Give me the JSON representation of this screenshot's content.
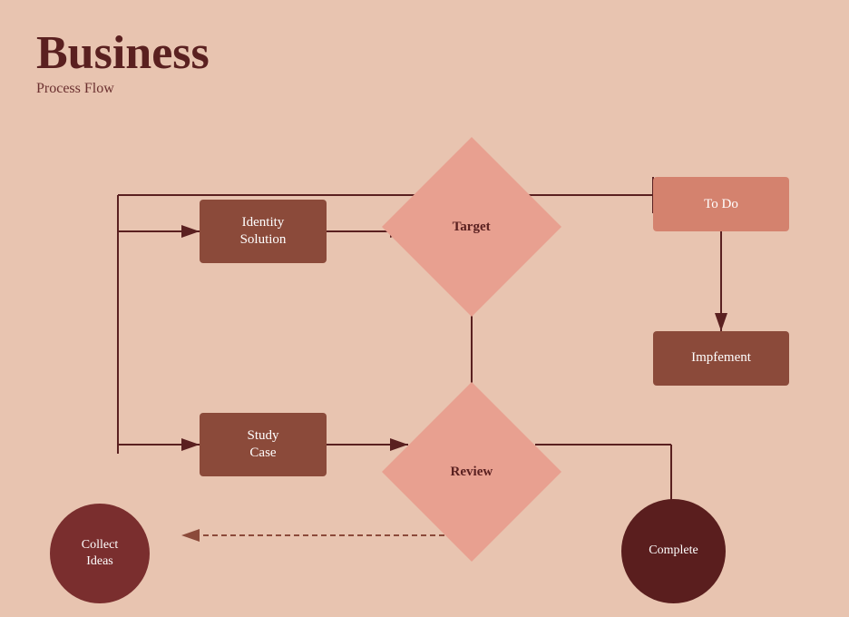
{
  "page": {
    "title": "Business",
    "subtitle": "Process Flow"
  },
  "nodes": {
    "identity_solution": {
      "label": "Identity\nSolution"
    },
    "target": {
      "label": "Target"
    },
    "todo": {
      "label": "To Do"
    },
    "implement": {
      "label": "Impfement"
    },
    "study_case": {
      "label": "Study\nCase"
    },
    "review": {
      "label": "Review"
    },
    "collect_ideas": {
      "label": "Collect\nIdeas"
    },
    "complete": {
      "label": "Complete"
    }
  },
  "colors": {
    "background": "#e8c4b0",
    "title": "#5a2020",
    "rect_brown": "#8b4a3a",
    "rect_light": "#d4826e",
    "diamond": "#e8a090",
    "circle_dark": "#5a1e1e",
    "arrow": "#5a2020"
  }
}
